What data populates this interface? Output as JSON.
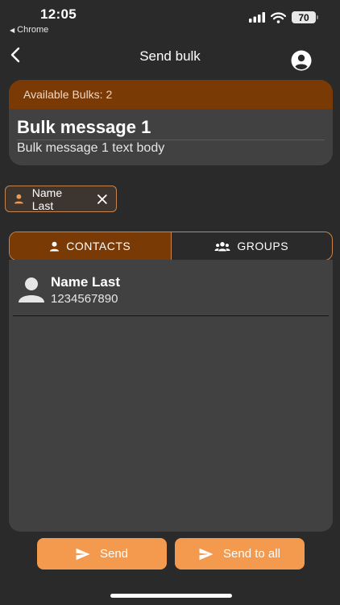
{
  "status_bar": {
    "time": "12:05",
    "back_app": "Chrome",
    "battery": "70"
  },
  "nav": {
    "title": "Send bulk"
  },
  "bulk_card": {
    "available": "Available Bulks: 2",
    "title": "Bulk message 1",
    "body": "Bulk message 1 text body"
  },
  "chip": {
    "label": "Name Last"
  },
  "tabs": [
    {
      "label": "CONTACTS",
      "active": true
    },
    {
      "label": "GROUPS",
      "active": false
    }
  ],
  "contacts": [
    {
      "name": "Name Last",
      "phone": "1234567890"
    }
  ],
  "buttons": {
    "send_label": "Send",
    "send_all_label": "Send to all"
  },
  "colors": {
    "accent": "#f39a4f",
    "accent_dark": "#7a3a06",
    "background": "#2a2a2a",
    "card": "#414141"
  }
}
